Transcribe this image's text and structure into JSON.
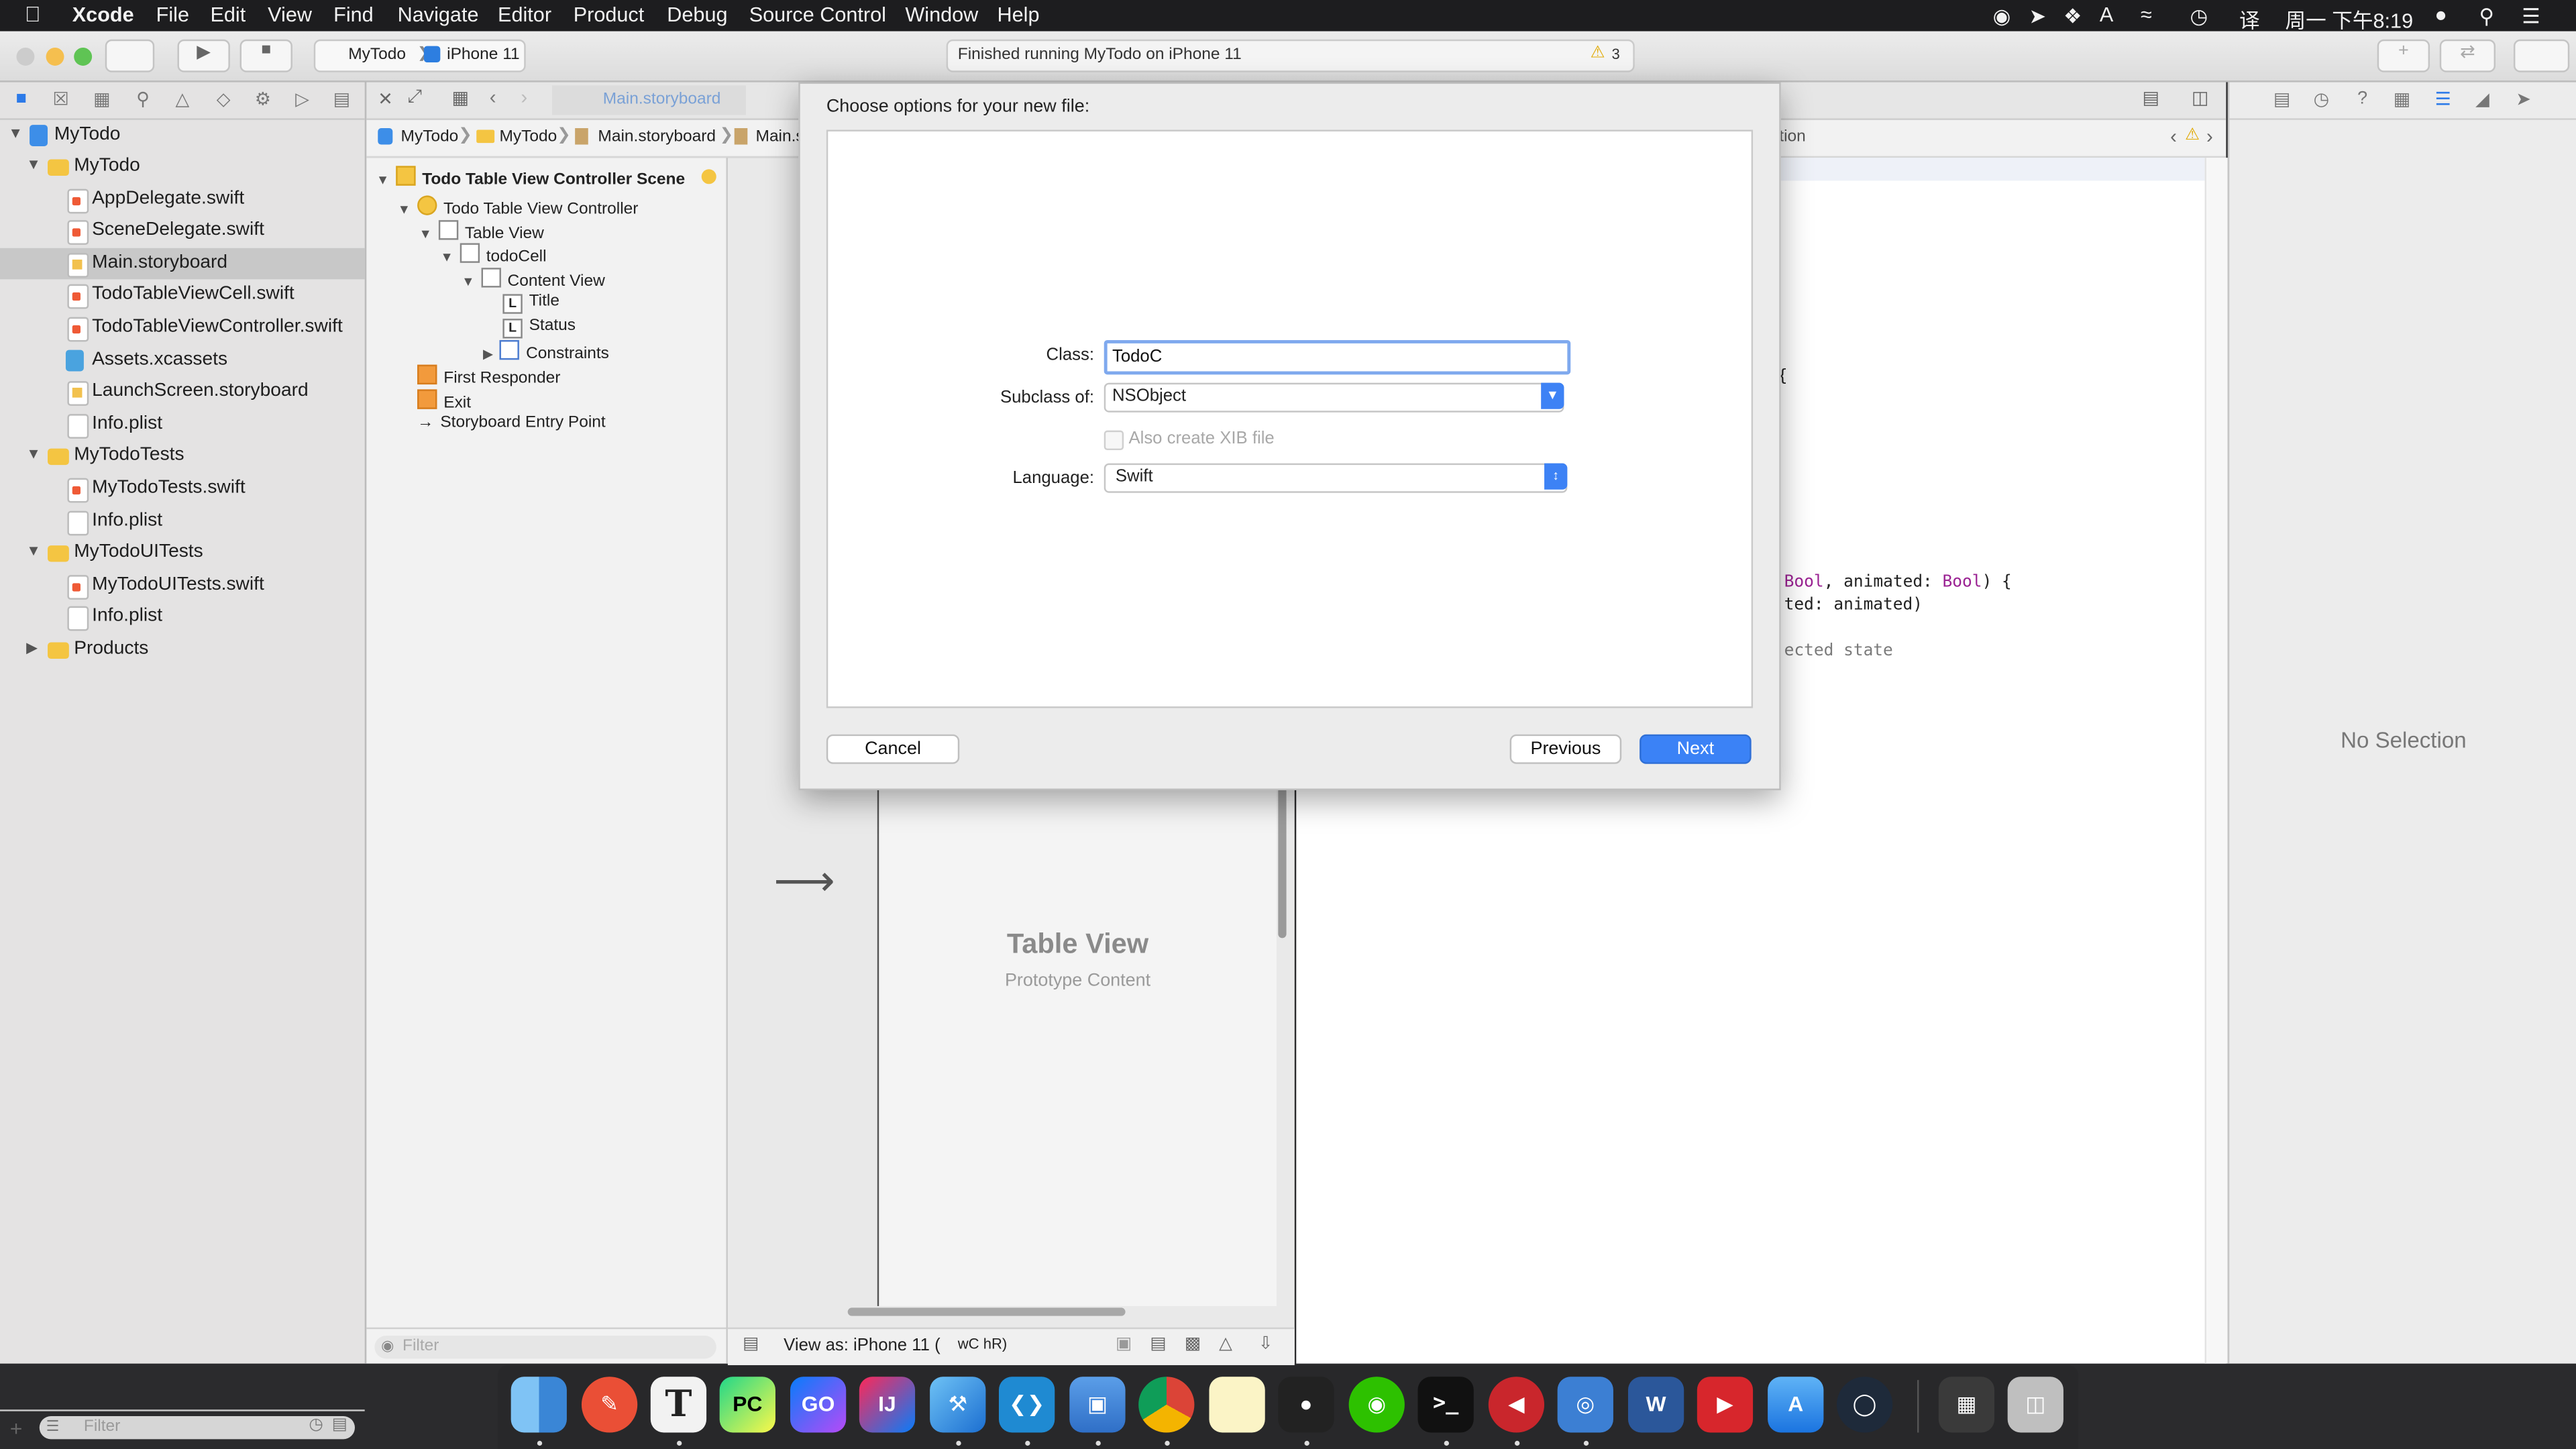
{
  "menubar": {
    "app": "Xcode",
    "items": [
      "File",
      "Edit",
      "View",
      "Find",
      "Navigate",
      "Editor",
      "Product",
      "Debug",
      "Source Control",
      "Window",
      "Help"
    ],
    "clock": "周一 下午8:19"
  },
  "toolbar": {
    "scheme": "MyTodo",
    "device": "iPhone 11",
    "activity": "Finished running MyTodo on iPhone 11",
    "warnings": "3"
  },
  "navigator": {
    "items": [
      {
        "label": "MyTodo"
      },
      {
        "label": "MyTodo"
      },
      {
        "label": "AppDelegate.swift"
      },
      {
        "label": "SceneDelegate.swift"
      },
      {
        "label": "Main.storyboard"
      },
      {
        "label": "TodoTableViewCell.swift"
      },
      {
        "label": "TodoTableViewController.swift"
      },
      {
        "label": "Assets.xcassets"
      },
      {
        "label": "LaunchScreen.storyboard"
      },
      {
        "label": "Info.plist"
      },
      {
        "label": "MyTodoTests"
      },
      {
        "label": "MyTodoTests.swift"
      },
      {
        "label": "Info.plist"
      },
      {
        "label": "MyTodoUITests"
      },
      {
        "label": "MyTodoUITests.swift"
      },
      {
        "label": "Info.plist"
      },
      {
        "label": "Products"
      }
    ],
    "filter_placeholder": "Filter"
  },
  "jumpbar": {
    "tab": "Main.storyboard",
    "crumbs": [
      "MyTodo",
      "MyTodo",
      "Main.storyboard",
      "Main.s"
    ]
  },
  "outline": {
    "items": [
      {
        "label": "Todo Table View Controller Scene"
      },
      {
        "label": "Todo Table View Controller"
      },
      {
        "label": "Table View"
      },
      {
        "label": "todoCell"
      },
      {
        "label": "Content View"
      },
      {
        "label": "Title",
        "glyph": "L"
      },
      {
        "label": "Status",
        "glyph": "L"
      },
      {
        "label": "Constraints"
      },
      {
        "label": "First Responder"
      },
      {
        "label": "Exit"
      },
      {
        "label": "Storyboard Entry Point"
      }
    ],
    "filter_placeholder": "Filter"
  },
  "canvas": {
    "table_title": "Table View",
    "table_sub": "Prototype Content",
    "view_as": "View as: iPhone 11 (",
    "view_as_traits": "wC hR)"
  },
  "editor": {
    "crumb": "tion",
    "code": [
      {
        "text": "{"
      },
      {
        "pre": "",
        "kw1": "Bool",
        "mid": ", animated: ",
        "kw2": "Bool",
        "post": ") {"
      },
      {
        "text": "ted: animated)"
      },
      {
        "text": "ected state"
      }
    ]
  },
  "inspector": {
    "empty": "No Selection"
  },
  "dialog": {
    "title": "Choose options for your new file:",
    "class_label": "Class:",
    "class_value": "TodoC",
    "subclass_label": "Subclass of:",
    "subclass_value": "NSObject",
    "xib_label": "Also create XIB file",
    "language_label": "Language:",
    "language_value": "Swift",
    "cancel": "Cancel",
    "previous": "Previous",
    "next": "Next"
  },
  "dock": {
    "apps": [
      "finder-icon",
      "pencil-icon",
      "typora-icon",
      "pycharm-icon",
      "goland-icon",
      "intellij-icon",
      "xcode-icon",
      "vscode-icon",
      "simulator-icon",
      "chrome-icon",
      "notes-icon",
      "qq-icon",
      "wechat-icon",
      "terminal-icon",
      "parallels-icon",
      "network-icon",
      "word-icon",
      "pdf-icon",
      "appstore-icon",
      "proxy-icon",
      "windows-icon",
      "trash-icon"
    ],
    "labels": {
      "pycharm": "PC",
      "goland": "GO",
      "intellij": "IJ",
      "word": "W",
      "typora": "T",
      "terminal": ">_"
    }
  }
}
